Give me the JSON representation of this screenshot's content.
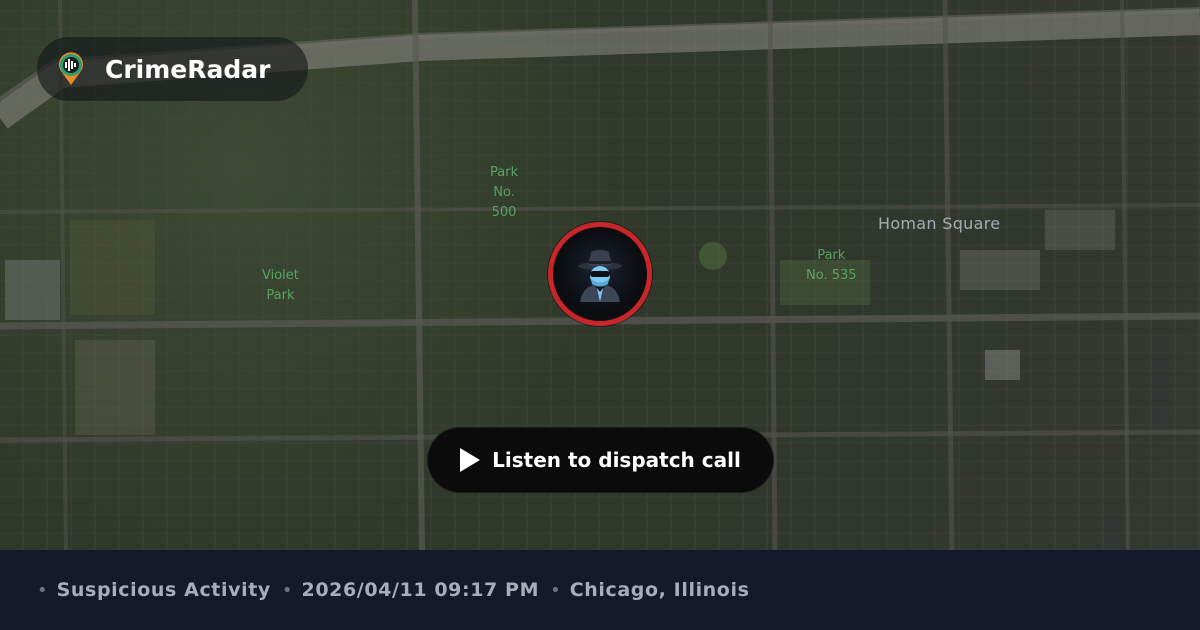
{
  "app": {
    "name": "CrimeRadar",
    "logo_icon": "radar-pin-icon"
  },
  "map": {
    "labels": {
      "park_500": "Park\nNo.\n500",
      "violet_park": "Violet\nPark",
      "homan_square": "Homan Square",
      "park_535": "Park\nNo. 535"
    }
  },
  "marker": {
    "icon": "incognito-spy-icon",
    "ring_color": "#c8262b"
  },
  "listen_button": {
    "label": "Listen to dispatch call",
    "icon": "play-icon"
  },
  "incident": {
    "type": "Suspicious Activity",
    "datetime": "2026/04/11 09:17 PM",
    "location": "Chicago, Illinois"
  }
}
